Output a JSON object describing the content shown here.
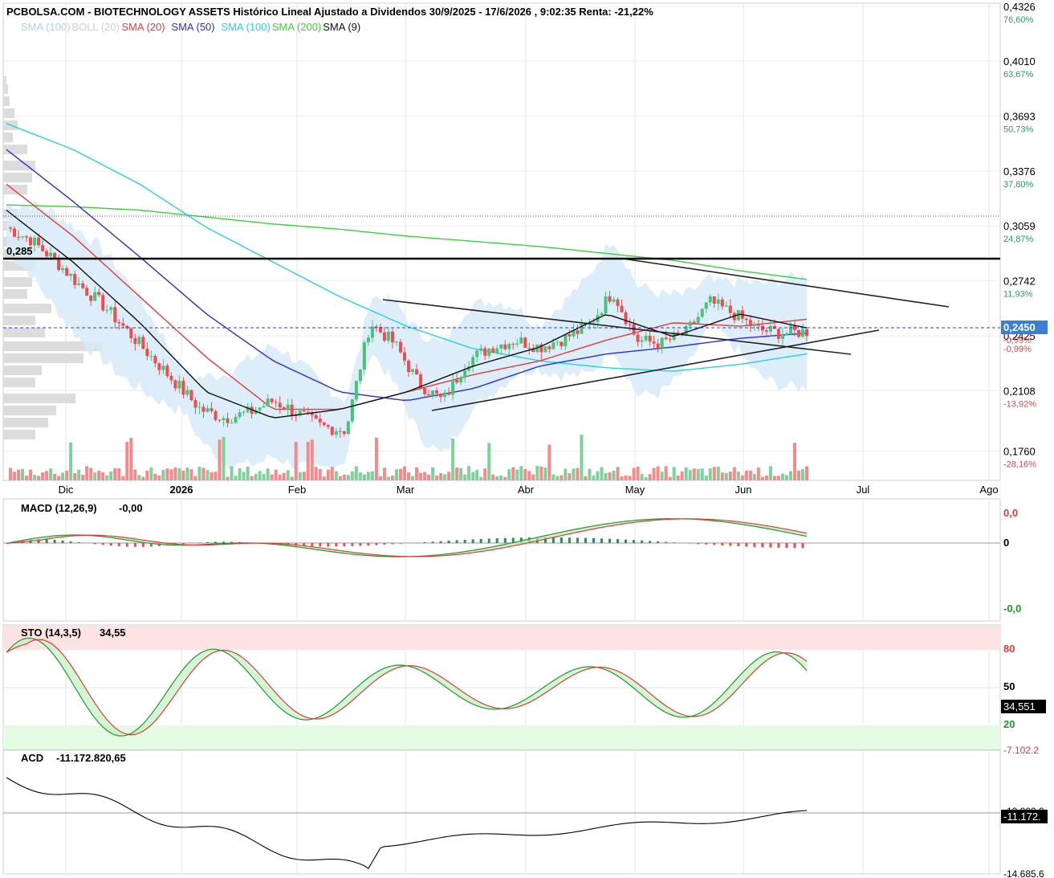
{
  "header": {
    "title": "PCBOLSA.COM - BIOTECHNOLOGY ASSETS Histórico Lineal Ajustado a Dividendos 30/9/2025 - 17/6/2026 , 9:02:35 Renta: -21,22%"
  },
  "legend": [
    {
      "label": "SMA (100)",
      "color": "#a6d4f0"
    },
    {
      "label": "BOLL (20)",
      "color": "#d0d0d0"
    },
    {
      "label": "SMA (20)",
      "color": "#e53935"
    },
    {
      "label": "SMA (50)",
      "color": "#2a2adf"
    },
    {
      "label": "SMA (100)",
      "color": "#22d3e8"
    },
    {
      "label": "SMA (200)",
      "color": "#3ad13a"
    },
    {
      "label": "SMA (9)",
      "color": "#111111"
    }
  ],
  "colors": {
    "up": "#4cc17a",
    "down": "#ef4d4d",
    "band": "#d7ebf9",
    "sma20": "#e53935",
    "sma50": "#2a2adf",
    "sma100": "#22d3e8",
    "sma200": "#3ad13a",
    "sma9": "#111111",
    "last_price_badge": "#3a7fd5"
  },
  "annotations": {
    "resistance_label": "0,285",
    "last_price_label": "0,2450",
    "last_price_pct": "-0,99%"
  },
  "indicators": {
    "macd_label": "MACD (12,26,9)",
    "macd_value": "-0,00",
    "macd_ticks": [
      "0,0",
      "0",
      "-0,0"
    ],
    "sto_label": "STO (14,3,5)",
    "sto_value": "34,55",
    "sto_ticks": [
      "80",
      "50",
      "20"
    ],
    "sto_badge": "34,551",
    "sto_cut_tick": "-7.102.2",
    "acd_label": "ACD",
    "acd_value": "-11.172.820,65",
    "acd_ticks": [
      "-10.000.0",
      "-14.685.6"
    ],
    "acd_badge": "-11.172."
  },
  "chart_data": {
    "type": "candlestick",
    "title": "PCBOLSA.COM - BIOTECHNOLOGY ASSETS Histórico Lineal Ajustado a Dividendos 30/9/2025 - 17/6/2026 , 9:02:35 Renta: -21,22%",
    "x_labels": [
      "Dic",
      "2026",
      "Feb",
      "Mar",
      "Abr",
      "May",
      "Jun",
      "Jul",
      "Ago"
    ],
    "y_ticks": [
      {
        "price": "0,4326",
        "pct": "76,60%"
      },
      {
        "price": "0,4010",
        "pct": "63,67%"
      },
      {
        "price": "0,3693",
        "pct": "50,73%"
      },
      {
        "price": "0,3376",
        "pct": "37,80%"
      },
      {
        "price": "0,3059",
        "pct": "24,87%"
      },
      {
        "price": "0,2742",
        "pct": "11,93%"
      },
      {
        "price": "0,2425",
        "pct": "-0,99%"
      },
      {
        "price": "0,2108",
        "pct": "-13,92%"
      },
      {
        "price": "0,1760",
        "pct": "-28,16%"
      }
    ],
    "ylim": [
      0.159,
      0.4326
    ],
    "last_price": 0.245,
    "resistance": 0.285,
    "price_series_sample": [
      0.305,
      0.298,
      0.286,
      0.272,
      0.26,
      0.245,
      0.23,
      0.215,
      0.2,
      0.195,
      0.198,
      0.205,
      0.198,
      0.19,
      0.188,
      0.25,
      0.238,
      0.215,
      0.205,
      0.228,
      0.236,
      0.24,
      0.236,
      0.241,
      0.248,
      0.268,
      0.24,
      0.238,
      0.244,
      0.262,
      0.255,
      0.246,
      0.244,
      0.245
    ],
    "series": [
      {
        "name": "SMA (200)",
        "values": [
          0.318,
          0.317,
          0.315,
          0.311,
          0.307,
          0.304,
          0.3,
          0.297,
          0.294,
          0.29,
          0.286,
          0.28,
          0.275
        ]
      },
      {
        "name": "SMA (100)",
        "values": [
          0.365,
          0.35,
          0.33,
          0.305,
          0.285,
          0.265,
          0.248,
          0.235,
          0.228,
          0.224,
          0.222,
          0.226,
          0.232
        ]
      },
      {
        "name": "SMA (50)",
        "values": [
          0.35,
          0.32,
          0.288,
          0.255,
          0.228,
          0.21,
          0.205,
          0.212,
          0.225,
          0.232,
          0.236,
          0.241,
          0.244
        ]
      },
      {
        "name": "SMA (20)",
        "values": [
          0.33,
          0.3,
          0.265,
          0.23,
          0.2,
          0.2,
          0.21,
          0.22,
          0.228,
          0.24,
          0.25,
          0.248,
          0.252
        ]
      },
      {
        "name": "SMA (9)",
        "values": [
          0.315,
          0.285,
          0.25,
          0.21,
          0.195,
          0.2,
          0.21,
          0.225,
          0.236,
          0.255,
          0.242,
          0.255,
          0.247
        ]
      }
    ]
  }
}
